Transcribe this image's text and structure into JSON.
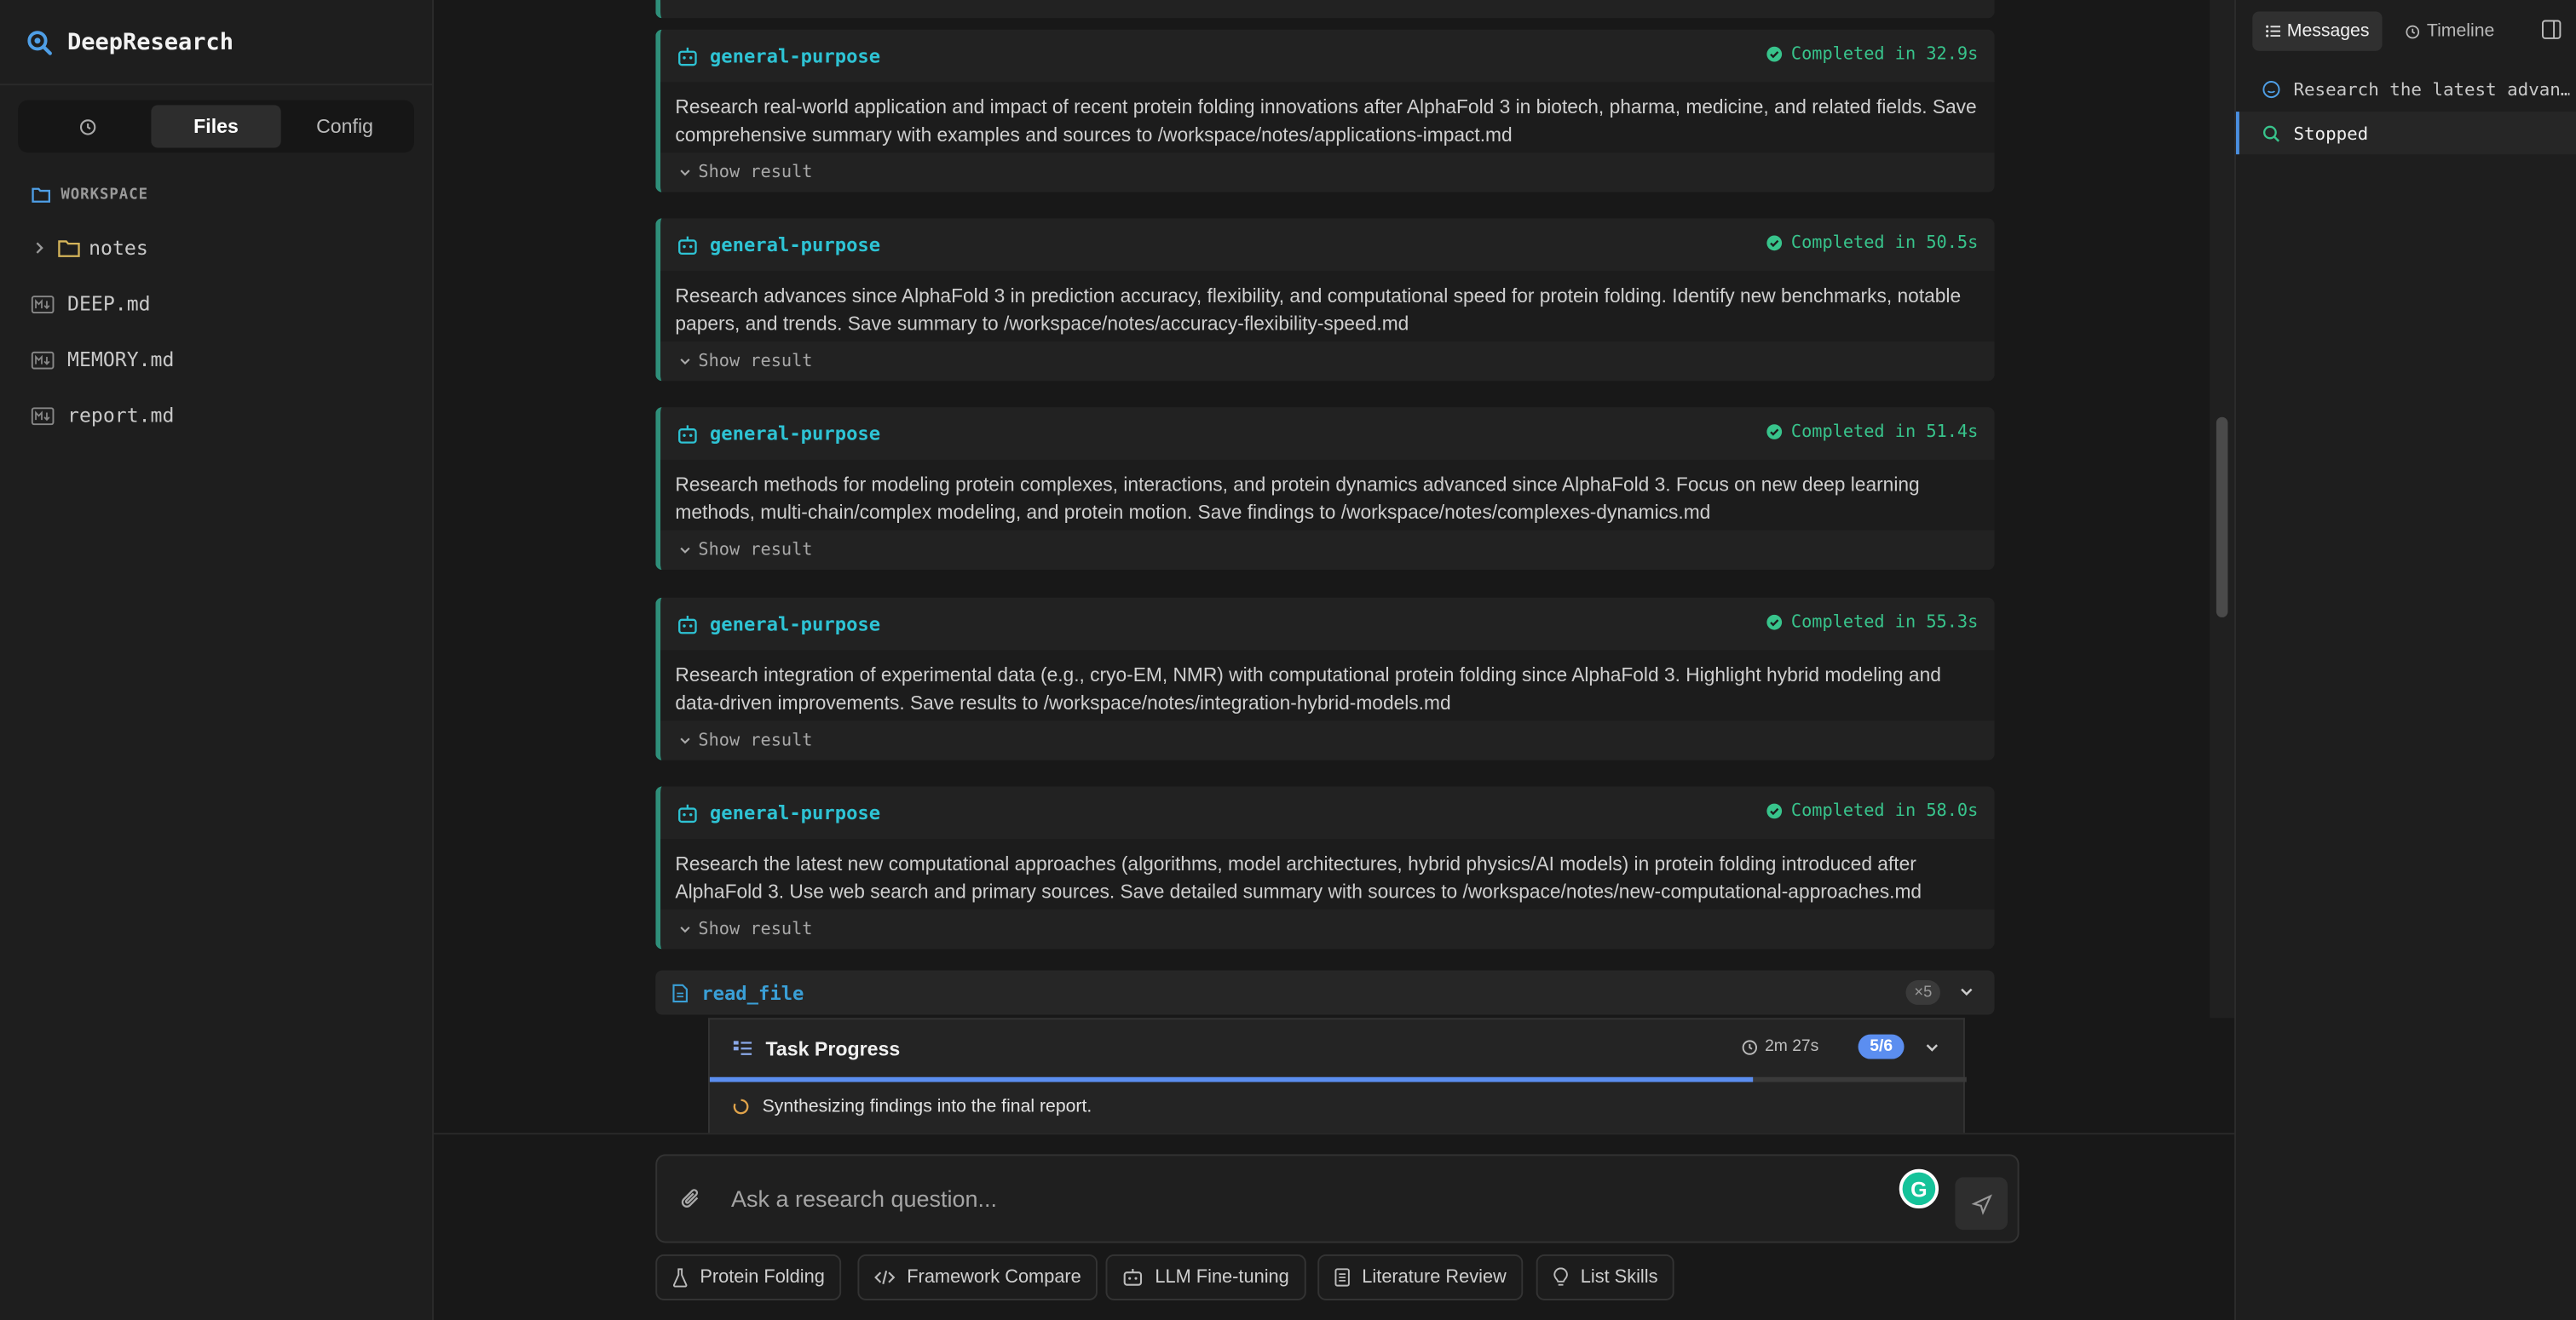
{
  "app": {
    "name": "DeepResearch"
  },
  "sidebar": {
    "tabs": [
      {
        "icon": "history-icon",
        "label": ""
      },
      {
        "label": "Files"
      },
      {
        "label": "Config"
      }
    ],
    "active_tab": "Files",
    "workspace_label": "WORKSPACE",
    "items": [
      {
        "name": "notes",
        "type": "folder"
      },
      {
        "name": "DEEP.md",
        "type": "file"
      },
      {
        "name": "MEMORY.md",
        "type": "file"
      },
      {
        "name": "report.md",
        "type": "file"
      }
    ]
  },
  "cards": [
    {
      "agent": "general-purpose",
      "status": "Completed in 32.9s",
      "task": "Research real-world application and impact of recent protein folding innovations after AlphaFold 3 in biotech, pharma, medicine, and related fields. Save comprehensive summary with examples and sources to /workspace/notes/applications-impact.md",
      "toggle": "Show result"
    },
    {
      "agent": "general-purpose",
      "status": "Completed in 50.5s",
      "task": "Research advances since AlphaFold 3 in prediction accuracy, flexibility, and computational speed for protein folding. Identify new benchmarks, notable papers, and trends. Save summary to /workspace/notes/accuracy-flexibility-speed.md",
      "toggle": "Show result"
    },
    {
      "agent": "general-purpose",
      "status": "Completed in 51.4s",
      "task": "Research methods for modeling protein complexes, interactions, and protein dynamics advanced since AlphaFold 3. Focus on new deep learning methods, multi-chain/complex modeling, and protein motion. Save findings to /workspace/notes/complexes-dynamics.md",
      "toggle": "Show result"
    },
    {
      "agent": "general-purpose",
      "status": "Completed in 55.3s",
      "task": "Research integration of experimental data (e.g., cryo-EM, NMR) with computational protein folding since AlphaFold 3. Highlight hybrid modeling and data-driven improvements. Save results to /workspace/notes/integration-hybrid-models.md",
      "toggle": "Show result"
    },
    {
      "agent": "general-purpose",
      "status": "Completed in 58.0s",
      "task": "Research the latest new computational approaches (algorithms, model architectures, hybrid physics/AI models) in protein folding introduced after AlphaFold 3. Use web search and primary sources. Save detailed summary with sources to /workspace/notes/new-computational-approaches.md",
      "toggle": "Show result"
    }
  ],
  "read_file": {
    "name": "read_file",
    "count": "×5"
  },
  "task_progress": {
    "title": "Task Progress",
    "elapsed": "2m 27s",
    "badge": "5/6",
    "progress": 0.83,
    "current": "Synthesizing findings into the final report."
  },
  "composer": {
    "placeholder": "Ask a research question..."
  },
  "suggestions": [
    {
      "label": "Protein Folding",
      "icon": "flask-icon"
    },
    {
      "label": "Framework Compare",
      "icon": "code-icon"
    },
    {
      "label": "LLM Fine-tuning",
      "icon": "robot-icon"
    },
    {
      "label": "Literature Review",
      "icon": "document-icon"
    },
    {
      "label": "List Skills",
      "icon": "lightbulb-icon"
    }
  ],
  "right_panel": {
    "tabs": [
      {
        "label": "Messages"
      },
      {
        "label": "Timeline"
      }
    ],
    "active_tab": "Messages",
    "messages": [
      {
        "text": "Research the latest advan…"
      },
      {
        "text": "Stopped"
      }
    ]
  },
  "colors": {
    "accent": "#2ec3d4",
    "success": "#38c48c",
    "progress": "#5b8ef0",
    "card_border": "#2f8f7a"
  }
}
